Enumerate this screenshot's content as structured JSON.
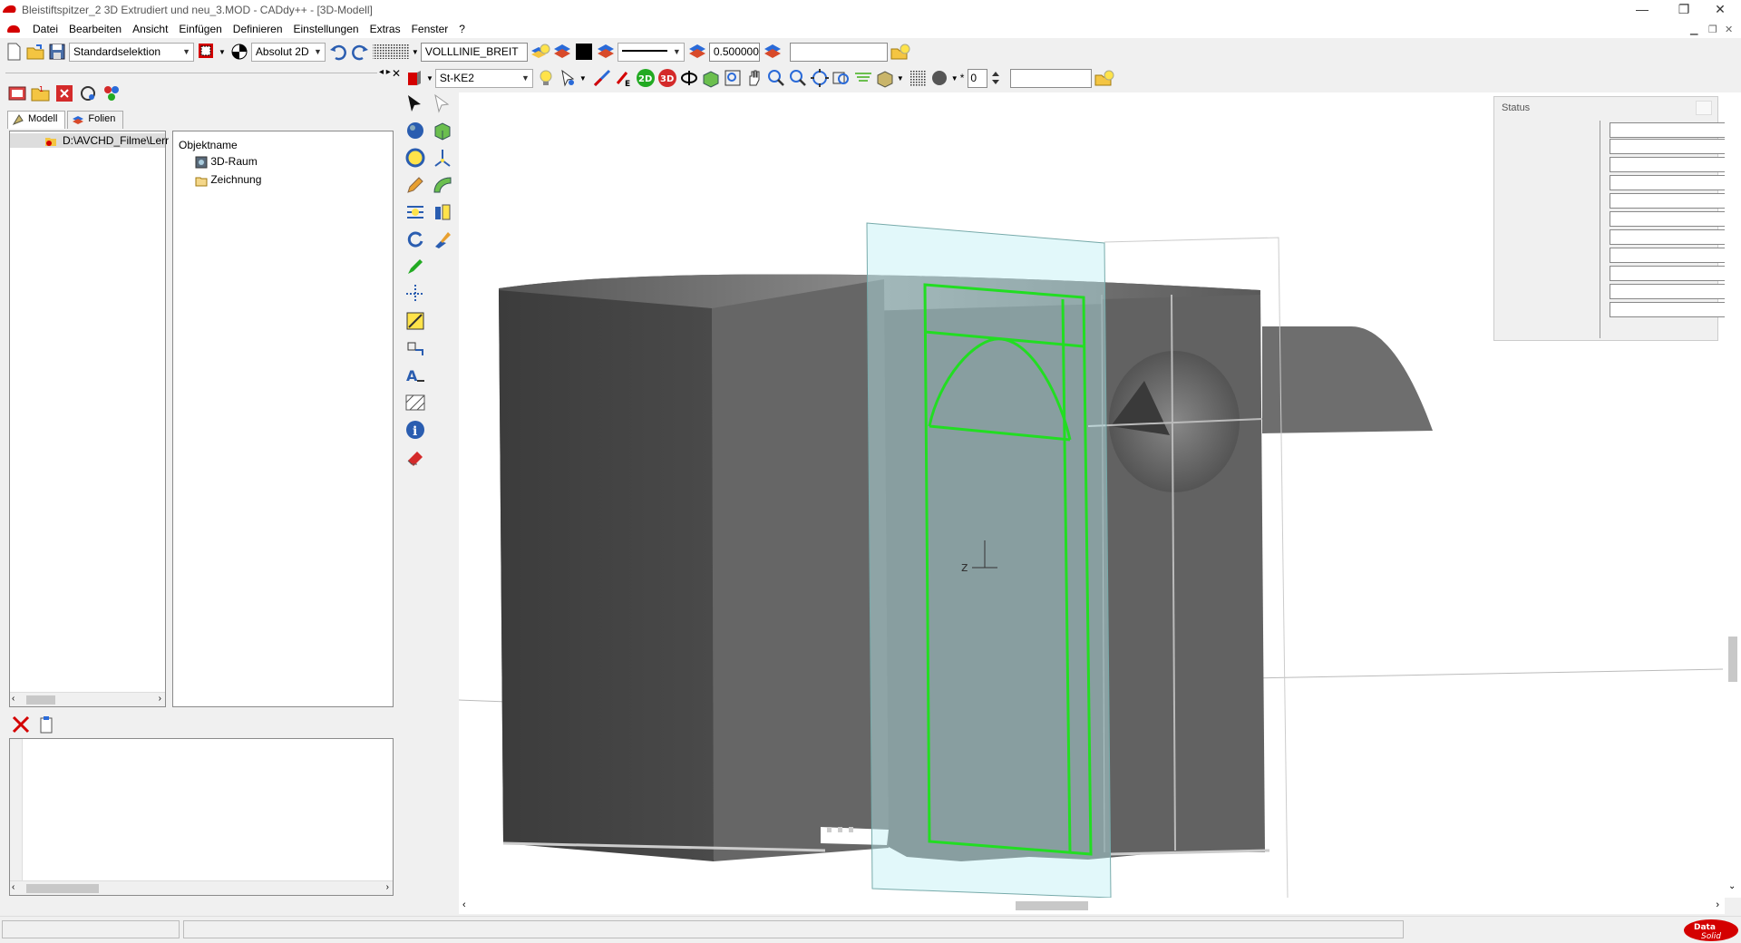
{
  "window": {
    "title": "Bleistiftspitzer_2 3D Extrudiert und neu_3.MOD  -  CADdy++ - [3D-Modell]",
    "minimize": "—",
    "restore": "❐",
    "close": "✕"
  },
  "menu": [
    "Datei",
    "Bearbeiten",
    "Ansicht",
    "Einfügen",
    "Definieren",
    "Einstellungen",
    "Extras",
    "Fenster",
    "?"
  ],
  "toolbar1": {
    "selection_mode": "Standardselektion",
    "coord_mode": "Absolut 2D",
    "line_type": "VOLLLINIE_BREIT",
    "line_width": "0.500000",
    "text_field": ""
  },
  "toolbar2": {
    "material": "St-KE2",
    "step_value": "0",
    "text_field": ""
  },
  "left_panel": {
    "tabs": [
      {
        "label": "Modell"
      },
      {
        "label": "Folien"
      }
    ],
    "path": "D:\\AVCHD_Filme\\Lerr",
    "object_header": "Objektname",
    "objects": [
      {
        "label": "3D-Raum"
      },
      {
        "label": "Zeichnung"
      }
    ]
  },
  "status_panel": {
    "title": "Status",
    "rows": [
      "",
      "",
      "",
      "",
      "",
      "",
      "",
      "",
      "",
      "",
      ""
    ]
  },
  "axis": {
    "z_label": "z"
  },
  "colors": {
    "accent_red": "#d40000",
    "highlight_green": "#22dd22",
    "model_grey": "#5a5a5a",
    "plane_cyan": "#bfeff5"
  },
  "brand": "Data Solid"
}
